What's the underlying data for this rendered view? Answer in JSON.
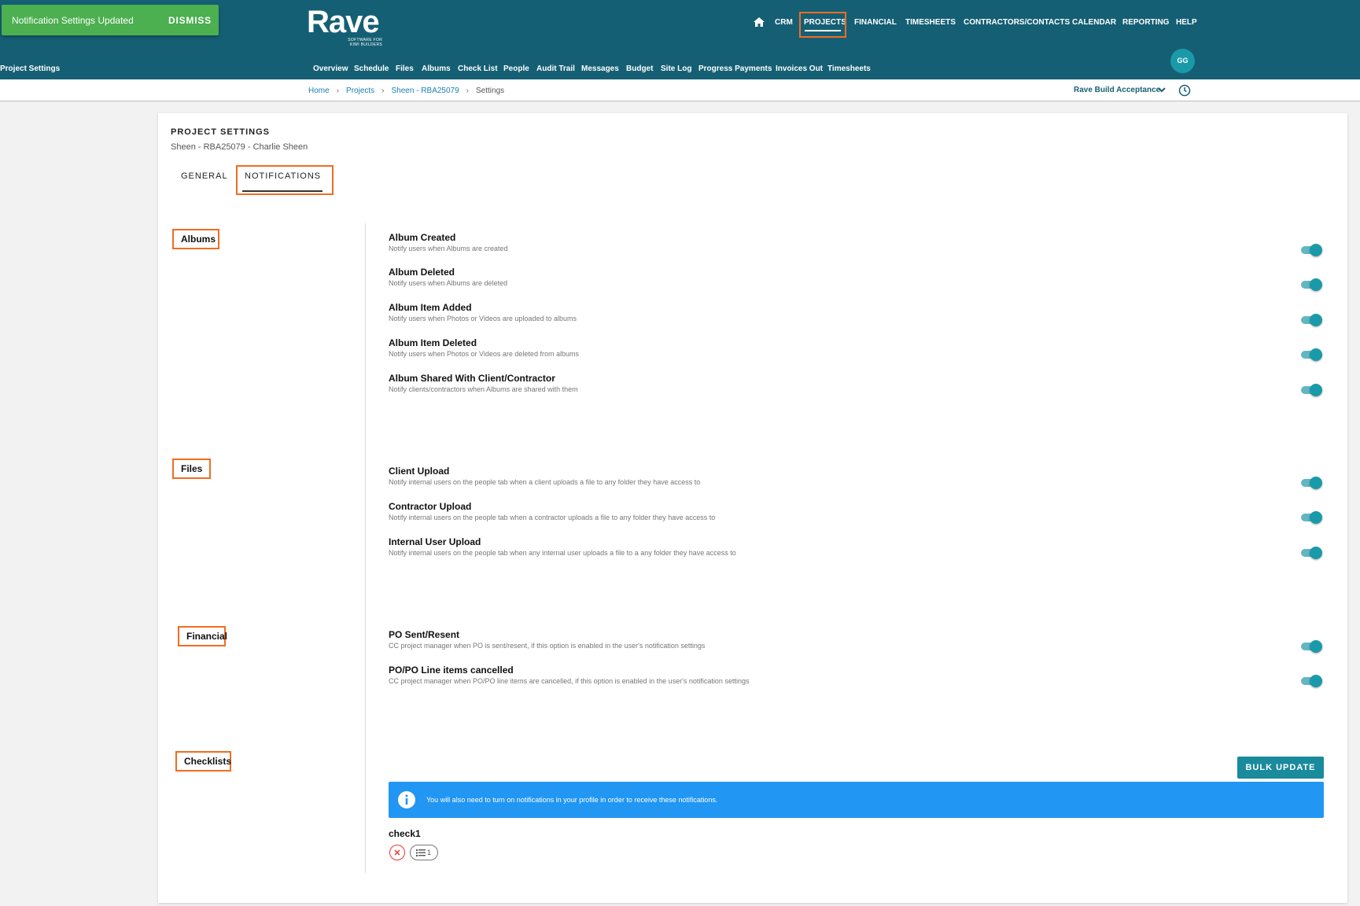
{
  "toast": {
    "message": "Notification Settings Updated",
    "action": "DISMISS"
  },
  "brand": {
    "name": "Rave",
    "tagline_line1": "SOFTWARE FOR",
    "tagline_line2": "KIWI BUILDERS"
  },
  "main_nav": [
    "CRM",
    "PROJECTS",
    "FINANCIAL",
    "TIMESHEETS",
    "CONTRACTORS/CONTACTS",
    "CALENDAR",
    "REPORTING",
    "HELP"
  ],
  "sub_nav": [
    "Overview",
    "Schedule",
    "Files",
    "Albums",
    "Check List",
    "People",
    "Audit Trail",
    "Messages",
    "Budget",
    "Site Log",
    "Progress Payments",
    "Invoices Out",
    "Timesheets",
    "Project Settings"
  ],
  "user": {
    "initials": "GG"
  },
  "breadcrumb": [
    "Home",
    "Projects",
    "Sheen - RBA25079",
    "Settings"
  ],
  "environment": "Rave Build Acceptance",
  "page": {
    "title": "PROJECT SETTINGS",
    "subtitle": "Sheen - RBA25079 - Charlie Sheen"
  },
  "tabs": [
    "GENERAL",
    "NOTIFICATIONS"
  ],
  "sections": {
    "albums": {
      "label": "Albums",
      "settings": [
        {
          "title": "Album Created",
          "desc": "Notify users when Albums are created",
          "enabled": true
        },
        {
          "title": "Album Deleted",
          "desc": "Notify users when Albums are deleted",
          "enabled": true
        },
        {
          "title": "Album Item Added",
          "desc": "Notify users when Photos or Videos are uploaded to albums",
          "enabled": true
        },
        {
          "title": "Album Item Deleted",
          "desc": "Notify users when Photos or Videos are deleted from albums",
          "enabled": true
        },
        {
          "title": "Album Shared With Client/Contractor",
          "desc": "Notify clients/contractors when Albums are shared with them",
          "enabled": true
        }
      ]
    },
    "files": {
      "label": "Files",
      "settings": [
        {
          "title": "Client Upload",
          "desc": "Notify internal users on the people tab when a client uploads a file to any folder they have access to",
          "enabled": true
        },
        {
          "title": "Contractor Upload",
          "desc": "Notify internal users on the people tab when a contractor uploads a file to any folder they have access to",
          "enabled": true
        },
        {
          "title": "Internal User Upload",
          "desc": "Notify internal users on the people tab when any internal user uploads a file to a any folder they have access to",
          "enabled": true
        }
      ]
    },
    "financial": {
      "label": "Financial",
      "settings": [
        {
          "title": "PO Sent/Resent",
          "desc": "CC project manager when PO is sent/resent, if this option is enabled in the user's notification settings",
          "enabled": true
        },
        {
          "title": "PO/PO Line items cancelled",
          "desc": "CC project manager when PO/PO line items are cancelled, if this option is enabled in the user's notification settings",
          "enabled": true
        }
      ]
    },
    "checklists": {
      "label": "Checklists",
      "bulk_update": "BULK UPDATE",
      "info": "You will also need to turn on notifications in your profile in order to receive these notifications.",
      "items": [
        {
          "name": "check1",
          "count": "1"
        }
      ]
    }
  },
  "colors": {
    "header": "#155f74",
    "accent": "#1a9aa9",
    "highlight": "#f36c21",
    "toast": "#4caf50",
    "info": "#2196f3"
  }
}
